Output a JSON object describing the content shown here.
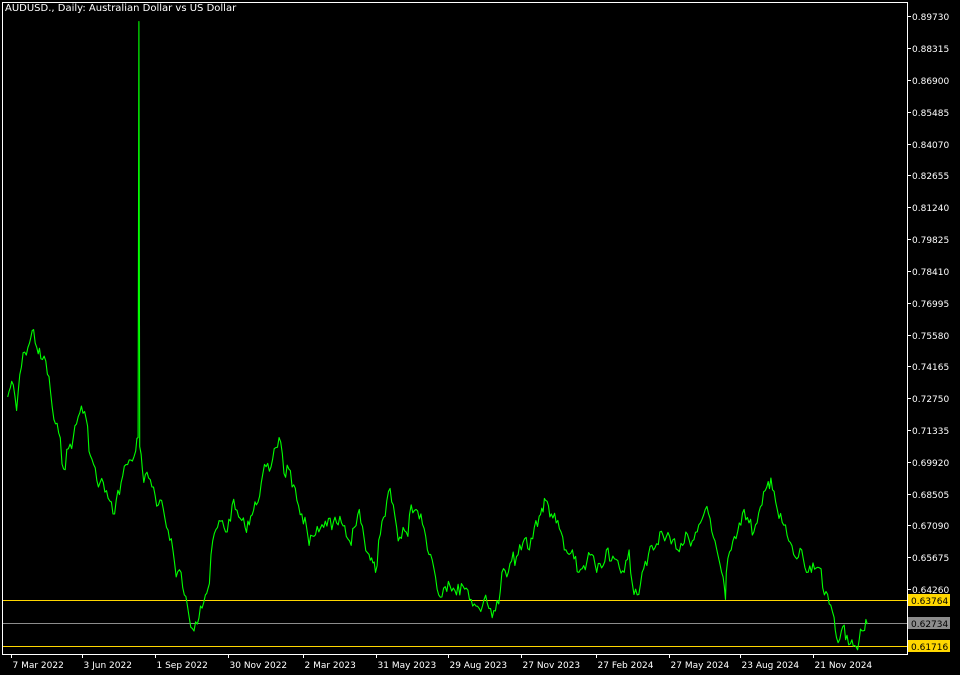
{
  "window": {
    "title": "AUDUSD., Daily:  Australian Dollar vs US Dollar"
  },
  "colors": {
    "background": "#000000",
    "frame": "#ffffff",
    "series": "#00ff00",
    "level_line": "#ffd700",
    "current_line": "#8c8c8c",
    "label_text": "#ffffff",
    "level_label_bg": "#ffd700",
    "current_label_bg": "#8c8c8c"
  },
  "chart_data": {
    "type": "line",
    "title": "AUDUSD., Daily:  Australian Dollar vs US Dollar",
    "xlabel": "",
    "ylabel": "",
    "ylim": [
      0.6137,
      0.9037
    ],
    "grid": false,
    "y_ticks": [
      "0.89730",
      "0.88315",
      "0.86900",
      "0.85485",
      "0.84070",
      "0.82655",
      "0.81240",
      "0.79825",
      "0.78410",
      "0.76995",
      "0.75580",
      "0.74165",
      "0.72750",
      "0.71335",
      "0.69920",
      "0.68505",
      "0.67090",
      "0.65675",
      "0.64260"
    ],
    "x_ticks": [
      "7 Mar 2022",
      "3 Jun 2022",
      "1 Sep 2022",
      "30 Nov 2022",
      "2 Mar 2023",
      "31 May 2023",
      "29 Aug 2023",
      "27 Nov 2023",
      "27 Feb 2024",
      "27 May 2024",
      "23 Aug 2024",
      "21 Nov 2024"
    ],
    "x_tick_dates": [
      "2022-03-07",
      "2022-06-03",
      "2022-09-01",
      "2022-11-30",
      "2023-03-02",
      "2023-05-31",
      "2023-08-29",
      "2023-11-27",
      "2024-02-27",
      "2024-05-27",
      "2024-08-23",
      "2024-11-21"
    ],
    "series": [
      {
        "values_note_free": true,
        "points": [
          [
            "2022-03-03",
            0.728
          ],
          [
            "2022-03-08",
            0.735
          ],
          [
            "2022-03-14",
            0.722
          ],
          [
            "2022-03-18",
            0.738
          ],
          [
            "2022-03-24",
            0.748
          ],
          [
            "2022-03-30",
            0.752
          ],
          [
            "2022-04-04",
            0.758
          ],
          [
            "2022-04-08",
            0.75
          ],
          [
            "2022-04-13",
            0.745
          ],
          [
            "2022-04-19",
            0.744
          ],
          [
            "2022-04-25",
            0.73
          ],
          [
            "2022-04-29",
            0.718
          ],
          [
            "2022-05-05",
            0.712
          ],
          [
            "2022-05-11",
            0.696
          ],
          [
            "2022-05-17",
            0.705
          ],
          [
            "2022-05-23",
            0.71
          ],
          [
            "2022-05-27",
            0.716
          ],
          [
            "2022-06-02",
            0.724
          ],
          [
            "2022-06-08",
            0.718
          ],
          [
            "2022-06-13",
            0.702
          ],
          [
            "2022-06-17",
            0.698
          ],
          [
            "2022-06-23",
            0.688
          ],
          [
            "2022-06-29",
            0.69
          ],
          [
            "2022-07-05",
            0.683
          ],
          [
            "2022-07-11",
            0.676
          ],
          [
            "2022-07-15",
            0.682
          ],
          [
            "2022-07-21",
            0.69
          ],
          [
            "2022-07-27",
            0.698
          ],
          [
            "2022-08-02",
            0.7
          ],
          [
            "2022-08-08",
            0.704
          ],
          [
            "2022-08-11",
            0.71
          ],
          [
            "2022-08-12",
            0.895
          ],
          [
            "2022-08-13",
            0.706
          ],
          [
            "2022-08-18",
            0.69
          ],
          [
            "2022-08-24",
            0.692
          ],
          [
            "2022-08-30",
            0.688
          ],
          [
            "2022-09-05",
            0.68
          ],
          [
            "2022-09-09",
            0.682
          ],
          [
            "2022-09-15",
            0.67
          ],
          [
            "2022-09-21",
            0.665
          ],
          [
            "2022-09-27",
            0.648
          ],
          [
            "2022-10-03",
            0.65
          ],
          [
            "2022-10-07",
            0.64
          ],
          [
            "2022-10-13",
            0.63
          ],
          [
            "2022-10-17",
            0.625
          ],
          [
            "2022-10-21",
            0.628
          ],
          [
            "2022-10-27",
            0.635
          ],
          [
            "2022-11-02",
            0.64
          ],
          [
            "2022-11-07",
            0.645
          ],
          [
            "2022-11-11",
            0.664
          ],
          [
            "2022-11-17",
            0.67
          ],
          [
            "2022-11-23",
            0.673
          ],
          [
            "2022-11-29",
            0.668
          ],
          [
            "2022-12-05",
            0.68
          ],
          [
            "2022-12-09",
            0.678
          ],
          [
            "2022-12-15",
            0.674
          ],
          [
            "2022-12-21",
            0.67
          ],
          [
            "2022-12-28",
            0.675
          ],
          [
            "2023-01-04",
            0.68
          ],
          [
            "2023-01-10",
            0.69
          ],
          [
            "2023-01-16",
            0.697
          ],
          [
            "2023-01-20",
            0.695
          ],
          [
            "2023-01-26",
            0.705
          ],
          [
            "2023-02-01",
            0.71
          ],
          [
            "2023-02-03",
            0.708
          ],
          [
            "2023-02-07",
            0.694
          ],
          [
            "2023-02-13",
            0.696
          ],
          [
            "2023-02-17",
            0.688
          ],
          [
            "2023-02-23",
            0.682
          ],
          [
            "2023-03-01",
            0.676
          ],
          [
            "2023-03-07",
            0.67
          ],
          [
            "2023-03-10",
            0.662
          ],
          [
            "2023-03-16",
            0.666
          ],
          [
            "2023-03-22",
            0.668
          ],
          [
            "2023-03-28",
            0.67
          ],
          [
            "2023-04-03",
            0.674
          ],
          [
            "2023-04-07",
            0.669
          ],
          [
            "2023-04-13",
            0.672
          ],
          [
            "2023-04-19",
            0.672
          ],
          [
            "2023-04-25",
            0.666
          ],
          [
            "2023-05-01",
            0.662
          ],
          [
            "2023-05-05",
            0.67
          ],
          [
            "2023-05-11",
            0.678
          ],
          [
            "2023-05-17",
            0.665
          ],
          [
            "2023-05-23",
            0.658
          ],
          [
            "2023-05-31",
            0.65
          ],
          [
            "2023-06-06",
            0.667
          ],
          [
            "2023-06-12",
            0.675
          ],
          [
            "2023-06-16",
            0.686
          ],
          [
            "2023-06-22",
            0.68
          ],
          [
            "2023-06-28",
            0.664
          ],
          [
            "2023-07-04",
            0.67
          ],
          [
            "2023-07-10",
            0.666
          ],
          [
            "2023-07-14",
            0.68
          ],
          [
            "2023-07-20",
            0.678
          ],
          [
            "2023-07-26",
            0.676
          ],
          [
            "2023-08-01",
            0.666
          ],
          [
            "2023-08-07",
            0.658
          ],
          [
            "2023-08-11",
            0.652
          ],
          [
            "2023-08-17",
            0.64
          ],
          [
            "2023-08-23",
            0.643
          ],
          [
            "2023-08-29",
            0.646
          ],
          [
            "2023-09-04",
            0.643
          ],
          [
            "2023-09-08",
            0.64
          ],
          [
            "2023-09-14",
            0.645
          ],
          [
            "2023-09-20",
            0.643
          ],
          [
            "2023-09-26",
            0.638
          ],
          [
            "2023-10-02",
            0.635
          ],
          [
            "2023-10-06",
            0.634
          ],
          [
            "2023-10-12",
            0.638
          ],
          [
            "2023-10-18",
            0.634
          ],
          [
            "2023-10-24",
            0.633
          ],
          [
            "2023-10-30",
            0.636
          ],
          [
            "2023-11-03",
            0.65
          ],
          [
            "2023-11-09",
            0.648
          ],
          [
            "2023-11-15",
            0.655
          ],
          [
            "2023-11-21",
            0.657
          ],
          [
            "2023-11-27",
            0.66
          ],
          [
            "2023-12-01",
            0.665
          ],
          [
            "2023-12-07",
            0.66
          ],
          [
            "2023-12-13",
            0.67
          ],
          [
            "2023-12-19",
            0.675
          ],
          [
            "2023-12-27",
            0.682
          ],
          [
            "2024-01-03",
            0.676
          ],
          [
            "2024-01-09",
            0.672
          ],
          [
            "2024-01-15",
            0.668
          ],
          [
            "2024-01-19",
            0.66
          ],
          [
            "2024-01-25",
            0.658
          ],
          [
            "2024-01-31",
            0.656
          ],
          [
            "2024-02-06",
            0.65
          ],
          [
            "2024-02-12",
            0.653
          ],
          [
            "2024-02-16",
            0.655
          ],
          [
            "2024-02-22",
            0.658
          ],
          [
            "2024-02-28",
            0.65
          ],
          [
            "2024-03-05",
            0.652
          ],
          [
            "2024-03-11",
            0.66
          ],
          [
            "2024-03-15",
            0.655
          ],
          [
            "2024-03-21",
            0.656
          ],
          [
            "2024-03-27",
            0.652
          ],
          [
            "2024-04-02",
            0.65
          ],
          [
            "2024-04-08",
            0.66
          ],
          [
            "2024-04-12",
            0.645
          ],
          [
            "2024-04-18",
            0.64
          ],
          [
            "2024-04-24",
            0.65
          ],
          [
            "2024-04-30",
            0.653
          ],
          [
            "2024-05-06",
            0.662
          ],
          [
            "2024-05-10",
            0.661
          ],
          [
            "2024-05-16",
            0.668
          ],
          [
            "2024-05-22",
            0.664
          ],
          [
            "2024-05-28",
            0.666
          ],
          [
            "2024-06-03",
            0.665
          ],
          [
            "2024-06-07",
            0.66
          ],
          [
            "2024-06-13",
            0.662
          ],
          [
            "2024-06-19",
            0.667
          ],
          [
            "2024-06-25",
            0.664
          ],
          [
            "2024-07-01",
            0.668
          ],
          [
            "2024-07-05",
            0.672
          ],
          [
            "2024-07-11",
            0.678
          ],
          [
            "2024-07-17",
            0.674
          ],
          [
            "2024-07-23",
            0.664
          ],
          [
            "2024-07-29",
            0.654
          ],
          [
            "2024-08-02",
            0.648
          ],
          [
            "2024-08-05",
            0.638
          ],
          [
            "2024-08-06",
            0.65
          ],
          [
            "2024-08-12",
            0.66
          ],
          [
            "2024-08-16",
            0.666
          ],
          [
            "2024-08-22",
            0.672
          ],
          [
            "2024-08-28",
            0.678
          ],
          [
            "2024-09-03",
            0.672
          ],
          [
            "2024-09-09",
            0.668
          ],
          [
            "2024-09-13",
            0.672
          ],
          [
            "2024-09-19",
            0.68
          ],
          [
            "2024-09-25",
            0.688
          ],
          [
            "2024-09-30",
            0.692
          ],
          [
            "2024-10-04",
            0.686
          ],
          [
            "2024-10-10",
            0.674
          ],
          [
            "2024-10-16",
            0.671
          ],
          [
            "2024-10-22",
            0.664
          ],
          [
            "2024-10-28",
            0.658
          ],
          [
            "2024-11-01",
            0.656
          ],
          [
            "2024-11-07",
            0.66
          ],
          [
            "2024-11-13",
            0.65
          ],
          [
            "2024-11-19",
            0.65
          ],
          [
            "2024-11-25",
            0.652
          ],
          [
            "2024-11-29",
            0.652
          ],
          [
            "2024-12-05",
            0.64
          ],
          [
            "2024-12-11",
            0.636
          ],
          [
            "2024-12-17",
            0.63
          ],
          [
            "2024-12-20",
            0.621
          ],
          [
            "2024-12-26",
            0.624
          ],
          [
            "2025-01-02",
            0.622
          ],
          [
            "2025-01-08",
            0.62
          ],
          [
            "2025-01-13",
            0.617
          ],
          [
            "2025-01-17",
            0.62
          ],
          [
            "2025-01-22",
            0.624
          ],
          [
            "2025-01-27",
            0.627
          ]
        ]
      }
    ],
    "levels": [
      {
        "value": 0.63764,
        "label": "0.63764",
        "kind": "level"
      },
      {
        "value": 0.62734,
        "label": "0.62734",
        "kind": "current"
      },
      {
        "value": 0.61716,
        "label": "0.61716",
        "kind": "level"
      }
    ]
  }
}
